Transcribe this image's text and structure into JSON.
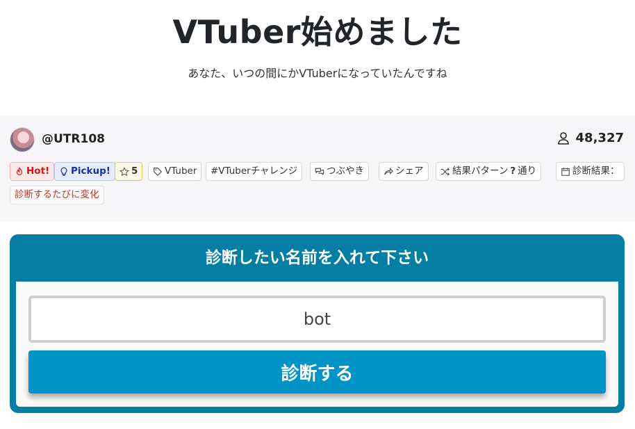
{
  "title": "VTuber始めました",
  "subtitle": "あなた、いつの間にかVTuberになっていたんですね",
  "author": {
    "handle": "@UTR108"
  },
  "views": "48,327",
  "tags": [
    {
      "label": "Hot!",
      "kind": "hot",
      "icon": "flame-icon"
    },
    {
      "label": "Pickup!",
      "kind": "pick",
      "icon": "lightbulb-icon"
    },
    {
      "label": "5",
      "kind": "star",
      "icon": "star-icon"
    },
    {
      "label": "VTuber",
      "kind": "plain",
      "icon": "tag-icon"
    },
    {
      "label": "#VTuberチャレンジ",
      "kind": "plain",
      "icon": ""
    },
    {
      "label": "つぶやき",
      "kind": "plain",
      "icon": "chat-icon"
    },
    {
      "label": "シェア",
      "kind": "plain",
      "icon": "share-arrow-icon"
    },
    {
      "label_prefix": "結果パターン",
      "label_value": "?",
      "label_suffix": "通り",
      "kind": "plain",
      "icon": "shuffle-icon"
    },
    {
      "label": "診断結果：",
      "kind": "plain",
      "icon": "calendar-icon"
    },
    {
      "label": "診断するたびに変化",
      "kind": "change",
      "icon": ""
    }
  ],
  "form": {
    "heading": "診断したい名前を入れて下さい",
    "name_value": "bot",
    "submit_label": "診断する"
  },
  "colors": {
    "card": "#047fa3",
    "button": "#0194c6",
    "hot": "#d11",
    "pickup": "#1a2fa8"
  }
}
